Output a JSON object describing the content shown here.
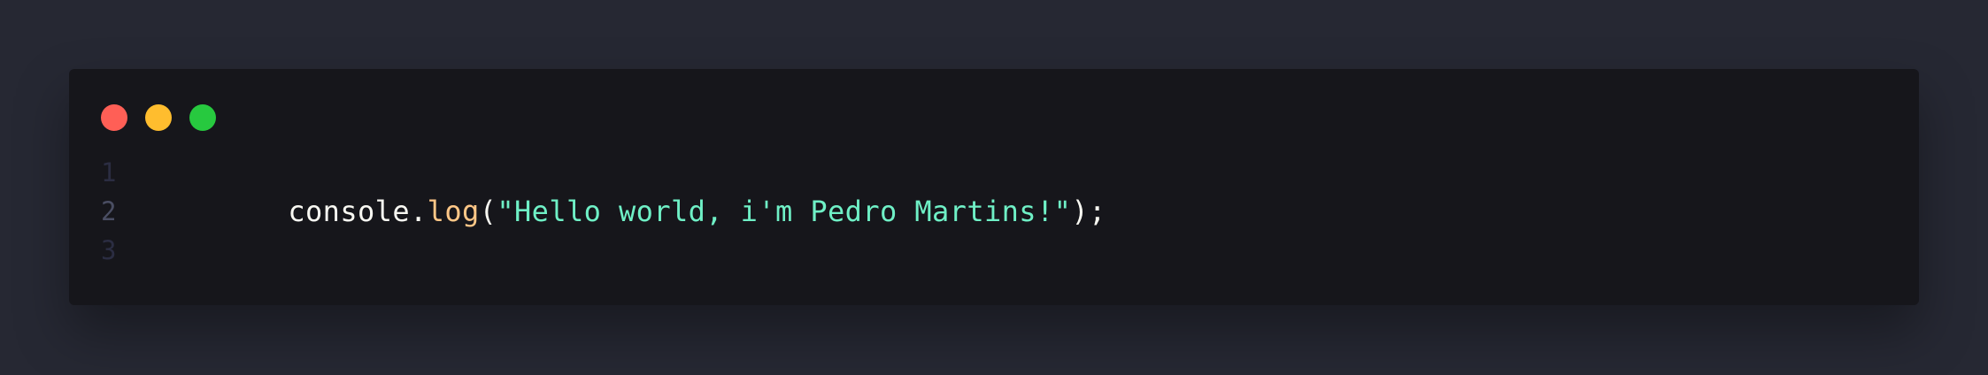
{
  "window": {
    "controls": [
      {
        "name": "close-icon",
        "color": "#ff5f56"
      },
      {
        "name": "minimize-icon",
        "color": "#ffbd2e"
      },
      {
        "name": "maximize-icon",
        "color": "#27c93f"
      }
    ]
  },
  "editor": {
    "lines": [
      {
        "number": "1",
        "tokens": []
      },
      {
        "number": "2",
        "tokens": [
          {
            "text": "console",
            "color": "#f8f8f2"
          },
          {
            "text": ".",
            "color": "#f8f8f2"
          },
          {
            "text": "log",
            "color": "#ffc787"
          },
          {
            "text": "(",
            "color": "#f8f8f2"
          },
          {
            "text": "\"Hello world, i'm Pedro Martins!\"",
            "color": "#6ff0c6"
          },
          {
            "text": ")",
            "color": "#f8f8f2"
          },
          {
            "text": ";",
            "color": "#f8f8f2"
          }
        ]
      },
      {
        "number": "3",
        "tokens": []
      }
    ],
    "colors": {
      "line_number": "#2b2d42",
      "active_line_number": "#4a4e63",
      "background": "#16161b",
      "page_background": "#262833"
    }
  }
}
